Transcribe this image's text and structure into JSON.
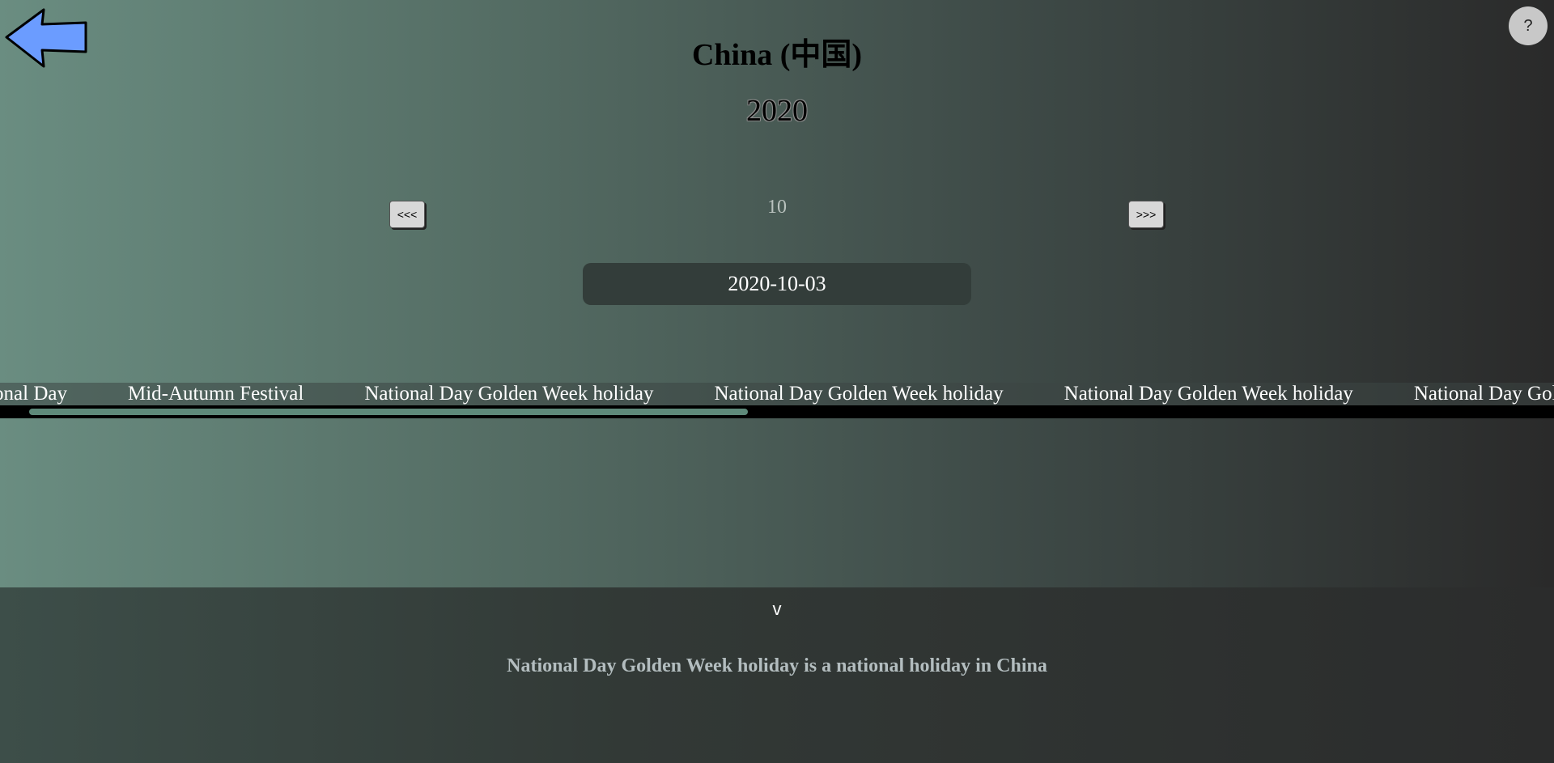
{
  "header": {
    "title": "China (中国)",
    "year": "2020",
    "help_label": "?"
  },
  "nav": {
    "prev_label": "<<<",
    "next_label": ">>>",
    "month": "10"
  },
  "selected_date": "2020-10-03",
  "holidays": [
    "National Day",
    "Mid-Autumn Festival",
    "National Day Golden Week holiday",
    "National Day Golden Week holiday",
    "National Day Golden Week holiday",
    "National Day Golden Week holiday"
  ],
  "details": {
    "toggle_label": "v",
    "description": "National Day Golden Week holiday is a national holiday in China"
  },
  "colors": {
    "back_arrow": "#6b9cff",
    "scroll_thumb": "#5e8a7a"
  },
  "icons": {
    "back": "back-arrow-icon",
    "help": "help-icon"
  }
}
